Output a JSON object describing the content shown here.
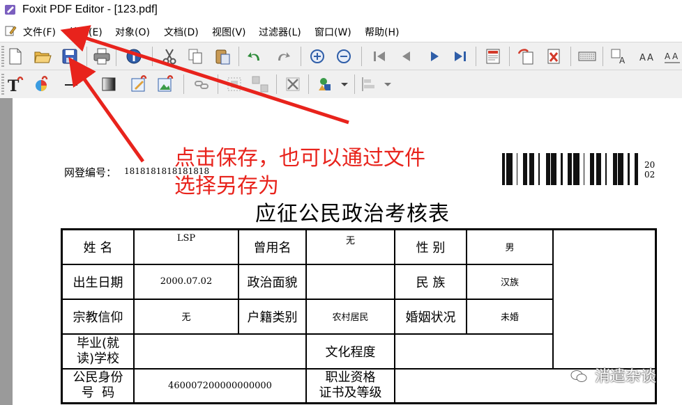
{
  "window": {
    "title": "Foxit PDF Editor - [123.pdf]"
  },
  "menu": [
    "文件(F)",
    "编辑(E)",
    "对象(O)",
    "文档(D)",
    "视图(V)",
    "过滤器(L)",
    "窗口(W)",
    "帮助(H)"
  ],
  "toolbar1_icons": [
    "new-document-icon",
    "open-folder-icon",
    "save-icon",
    "print-icon",
    "properties-icon",
    "cut-icon",
    "copy-icon",
    "paste-icon",
    "undo-icon",
    "redo-icon",
    "zoom-in-icon",
    "zoom-out-icon",
    "first-page-icon",
    "previous-page-icon",
    "next-page-icon",
    "last-page-icon",
    "page-properties-icon",
    "insert-page-icon",
    "delete-page-icon",
    "keyboard-icon",
    "text-format-icon",
    "text-align-icon",
    "text-spacing-icon"
  ],
  "toolbar2_icons": [
    "add-text-icon",
    "color-picker-icon",
    "draw-line-icon",
    "shading-icon",
    "edit-image-icon",
    "image-properties-icon",
    "link-icon",
    "group-icon",
    "ungroup-icon",
    "delete-object-icon",
    "shapes-icon",
    "dropdown-icon",
    "align-icon",
    "dropdown-icon"
  ],
  "annotation": {
    "text": "点击保存，也可以通过文件\n选择另存为",
    "color": "#e8231c"
  },
  "document": {
    "reg_label": "网登编号：",
    "reg_number": "1818181818181818",
    "corner_number": "20\n02",
    "title": "应征公民政治考核表",
    "rows": [
      [
        "姓  名",
        "LSP",
        "曾用名",
        "无",
        "性  别",
        "男"
      ],
      [
        "出生日期",
        "2000.07.02",
        "政治面貌",
        "",
        "民  族",
        "汉族"
      ],
      [
        "宗教信仰",
        "无",
        "户籍类别",
        "农村居民",
        "婚姻状况",
        "未婚"
      ],
      [
        "毕业(就\n读)学校",
        "",
        "文化程度",
        ""
      ],
      [
        "公民身份\n号  码",
        "460007200000000000",
        "职业资格\n证书及等级",
        ""
      ]
    ]
  },
  "watermark": "消遣杂谈"
}
